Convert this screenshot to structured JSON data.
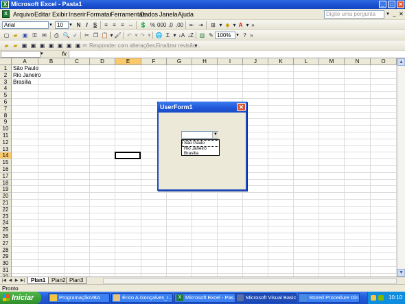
{
  "window": {
    "title": "Microsoft Excel - Pasta1",
    "buttons": [
      "_",
      "□",
      "✕"
    ]
  },
  "menu": {
    "items": [
      "Arquivo",
      "Editar",
      "Exibir",
      "Inserir",
      "Formatar",
      "Ferramentas",
      "Dados",
      "Janela",
      "Ajuda"
    ],
    "ask_placeholder": "Digite uma pergunta"
  },
  "format_toolbar": {
    "font": "Arial",
    "size": "10",
    "bold": "N",
    "italic": "I",
    "underline": "S",
    "zoom": "100%"
  },
  "review_toolbar": {
    "reply_changes": "Responder com alterações...",
    "end_review": "Finalizar revisão..."
  },
  "formula": {
    "name_box": "",
    "fx": "fx",
    "value": ""
  },
  "grid": {
    "columns": [
      "A",
      "B",
      "C",
      "D",
      "E",
      "F",
      "G",
      "H",
      "I",
      "J",
      "K",
      "L",
      "M",
      "N",
      "O"
    ],
    "rows": [
      "1",
      "2",
      "3",
      "4",
      "5",
      "6",
      "7",
      "8",
      "9",
      "10",
      "11",
      "12",
      "13",
      "14",
      "15",
      "16",
      "17",
      "18",
      "19",
      "20",
      "21",
      "22",
      "23",
      "24",
      "25",
      "26",
      "27",
      "28",
      "29",
      "30",
      "31",
      "32"
    ],
    "active_column": "E",
    "active_row": "14",
    "cells": {
      "A1": "São Paulo",
      "A2": "Rio Janeiro",
      "A3": "Brasilia"
    }
  },
  "sheets": [
    "Plan1",
    "Plan2",
    "Plan3"
  ],
  "active_sheet": "Plan1",
  "status": "Pronto",
  "userform": {
    "title": "UserForm1",
    "combo_value": "",
    "list_items": [
      "São Paulo",
      "Rio Janeiro",
      "Brasilia"
    ]
  },
  "taskbar": {
    "start": "Iniciar",
    "tasks": [
      {
        "label": "ProgramaçãoVBA",
        "icon_color": "#f4c542"
      },
      {
        "label": "Érico A.Gonçalves_I...",
        "icon_color": "#e8c27a"
      },
      {
        "label": "Microsoft Excel - Pas...",
        "icon_color": "#1e7b34"
      },
      {
        "label": "Microsoft Visual Basic...",
        "icon_color": "#5a6fa8"
      },
      {
        "label": "Stored Procedure Din...",
        "icon_color": "#4a8be0"
      }
    ],
    "active_task": 3,
    "clock": "10:10"
  }
}
